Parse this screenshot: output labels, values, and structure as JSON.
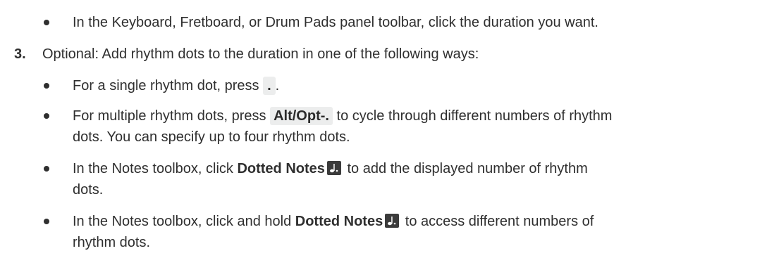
{
  "step3": {
    "number": "3.",
    "text": "Optional: Add rhythm dots to the duration in one of the following ways:"
  },
  "top_bullet": {
    "text": "In the Keyboard, Fretboard, or Drum Pads panel toolbar, click the duration you want."
  },
  "bullets": {
    "single": {
      "before": "For a single rhythm dot, press ",
      "key": ".",
      "after": "."
    },
    "multiple": {
      "before": "For multiple rhythm dots, press ",
      "key": "Alt/Opt-.",
      "after_line1": " to cycle through different numbers of rhythm",
      "line2": "dots. You can specify up to four rhythm dots."
    },
    "toolbox_click": {
      "before": "In the Notes toolbox, click ",
      "term": "Dotted Notes",
      "icon": "dotted-note-icon",
      "after_line1": " to add the displayed number of rhythm",
      "line2": "dots."
    },
    "toolbox_hold": {
      "before": "In the Notes toolbox, click and hold ",
      "term": "Dotted Notes",
      "icon": "dotted-note-icon",
      "after_line1": " to access different numbers of",
      "line2": "rhythm dots."
    }
  },
  "colors": {
    "text": "#2f2f2f",
    "kbd_background": "#eceded",
    "icon_background": "#3b3b3b"
  }
}
